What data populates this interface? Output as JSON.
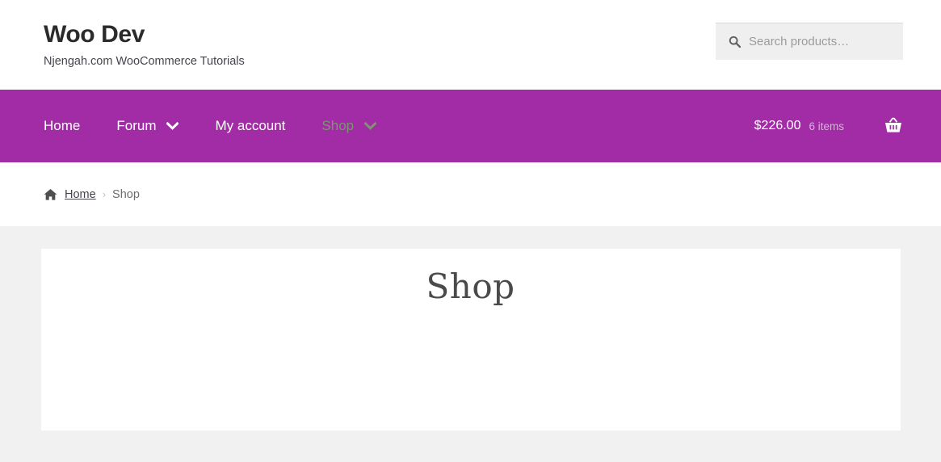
{
  "header": {
    "site_title": "Woo Dev",
    "tagline": "Njengah.com WooCommerce Tutorials",
    "search": {
      "placeholder": "Search products…",
      "value": "",
      "icon": "search-icon"
    }
  },
  "nav": {
    "background_color": "#a22ca6",
    "items": [
      {
        "label": "Home",
        "has_dropdown": false,
        "current": false
      },
      {
        "label": "Forum",
        "has_dropdown": true,
        "current": false
      },
      {
        "label": "My account",
        "has_dropdown": false,
        "current": false
      },
      {
        "label": "Shop",
        "has_dropdown": true,
        "current": true
      }
    ],
    "cart": {
      "amount": "$226.00",
      "items_text": "6 items",
      "icon": "shopping-basket-icon"
    }
  },
  "breadcrumb": {
    "home_icon": "home-icon",
    "home_label": "Home",
    "separator": "›",
    "current_label": "Shop"
  },
  "main": {
    "page_title": "Shop"
  },
  "colors": {
    "brand_purple": "#a22ca6",
    "page_background": "#f1f1f1",
    "card_background": "#ffffff",
    "current_nav_item": "#7d9471",
    "cart_count": "#d7b2d9"
  }
}
